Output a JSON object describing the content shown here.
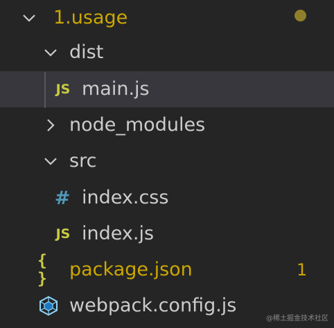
{
  "colors": {
    "background": "#252526",
    "selected_row": "#37373d",
    "modified": "#cca700",
    "default_text": "#cccccc",
    "js_icon": "#cbcb41",
    "css_icon": "#519aba",
    "webpack_icon": "#8ed6fb"
  },
  "tree": {
    "root": {
      "label": "1.usage",
      "expanded": true,
      "modified": true
    },
    "dist": {
      "label": "dist",
      "expanded": true
    },
    "main_js": {
      "label": "main.js",
      "icon": "js-icon",
      "icon_text": "JS",
      "selected": true
    },
    "node_modules": {
      "label": "node_modules",
      "expanded": false
    },
    "src": {
      "label": "src",
      "expanded": true
    },
    "index_css": {
      "label": "index.css",
      "icon": "css-icon",
      "icon_text": "#"
    },
    "index_js": {
      "label": "index.js",
      "icon": "js-icon",
      "icon_text": "JS"
    },
    "package_json": {
      "label": "package.json",
      "icon": "json-icon",
      "icon_text": "{ }",
      "problems": "1",
      "modified": true
    },
    "webpack_config": {
      "label": "webpack.config.js",
      "icon": "webpack-icon"
    }
  },
  "watermark": "@稀土掘金技术社区"
}
